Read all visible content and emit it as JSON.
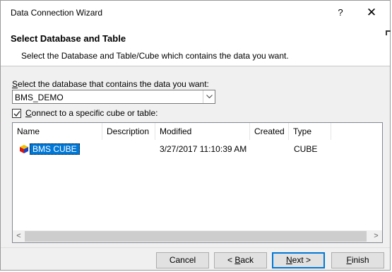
{
  "window": {
    "title": "Data Connection Wizard",
    "help_glyph": "?",
    "close_glyph": "✕"
  },
  "header": {
    "title": "Select Database and Table",
    "subtitle": "Select the Database and Table/Cube which contains the data you want."
  },
  "database": {
    "label_accel": "S",
    "label_rest": "elect the database that contains the data you want:",
    "selected": "BMS_DEMO"
  },
  "connect_checkbox": {
    "checked": true,
    "label_accel": "C",
    "label_rest": "onnect to a specific cube or table:"
  },
  "table": {
    "columns": [
      "Name",
      "Description",
      "Modified",
      "Created",
      "Type"
    ],
    "rows": [
      {
        "name": "BMS CUBE",
        "description": "",
        "modified": "3/27/2017 11:10:39 AM",
        "created": "",
        "type": "CUBE",
        "icon": "cube-icon",
        "selected": true
      }
    ],
    "scroll_left": "<",
    "scroll_right": ">"
  },
  "buttons": {
    "cancel": "Cancel",
    "back_prefix": "< ",
    "back_accel": "B",
    "back_rest": "ack",
    "next_accel": "N",
    "next_rest": "ext >",
    "finish_accel": "F",
    "finish_rest": "inish"
  },
  "colors": {
    "selection": "#0078d7",
    "dialog_bg": "#f0f0f0",
    "header_bg": "#ffffff"
  }
}
